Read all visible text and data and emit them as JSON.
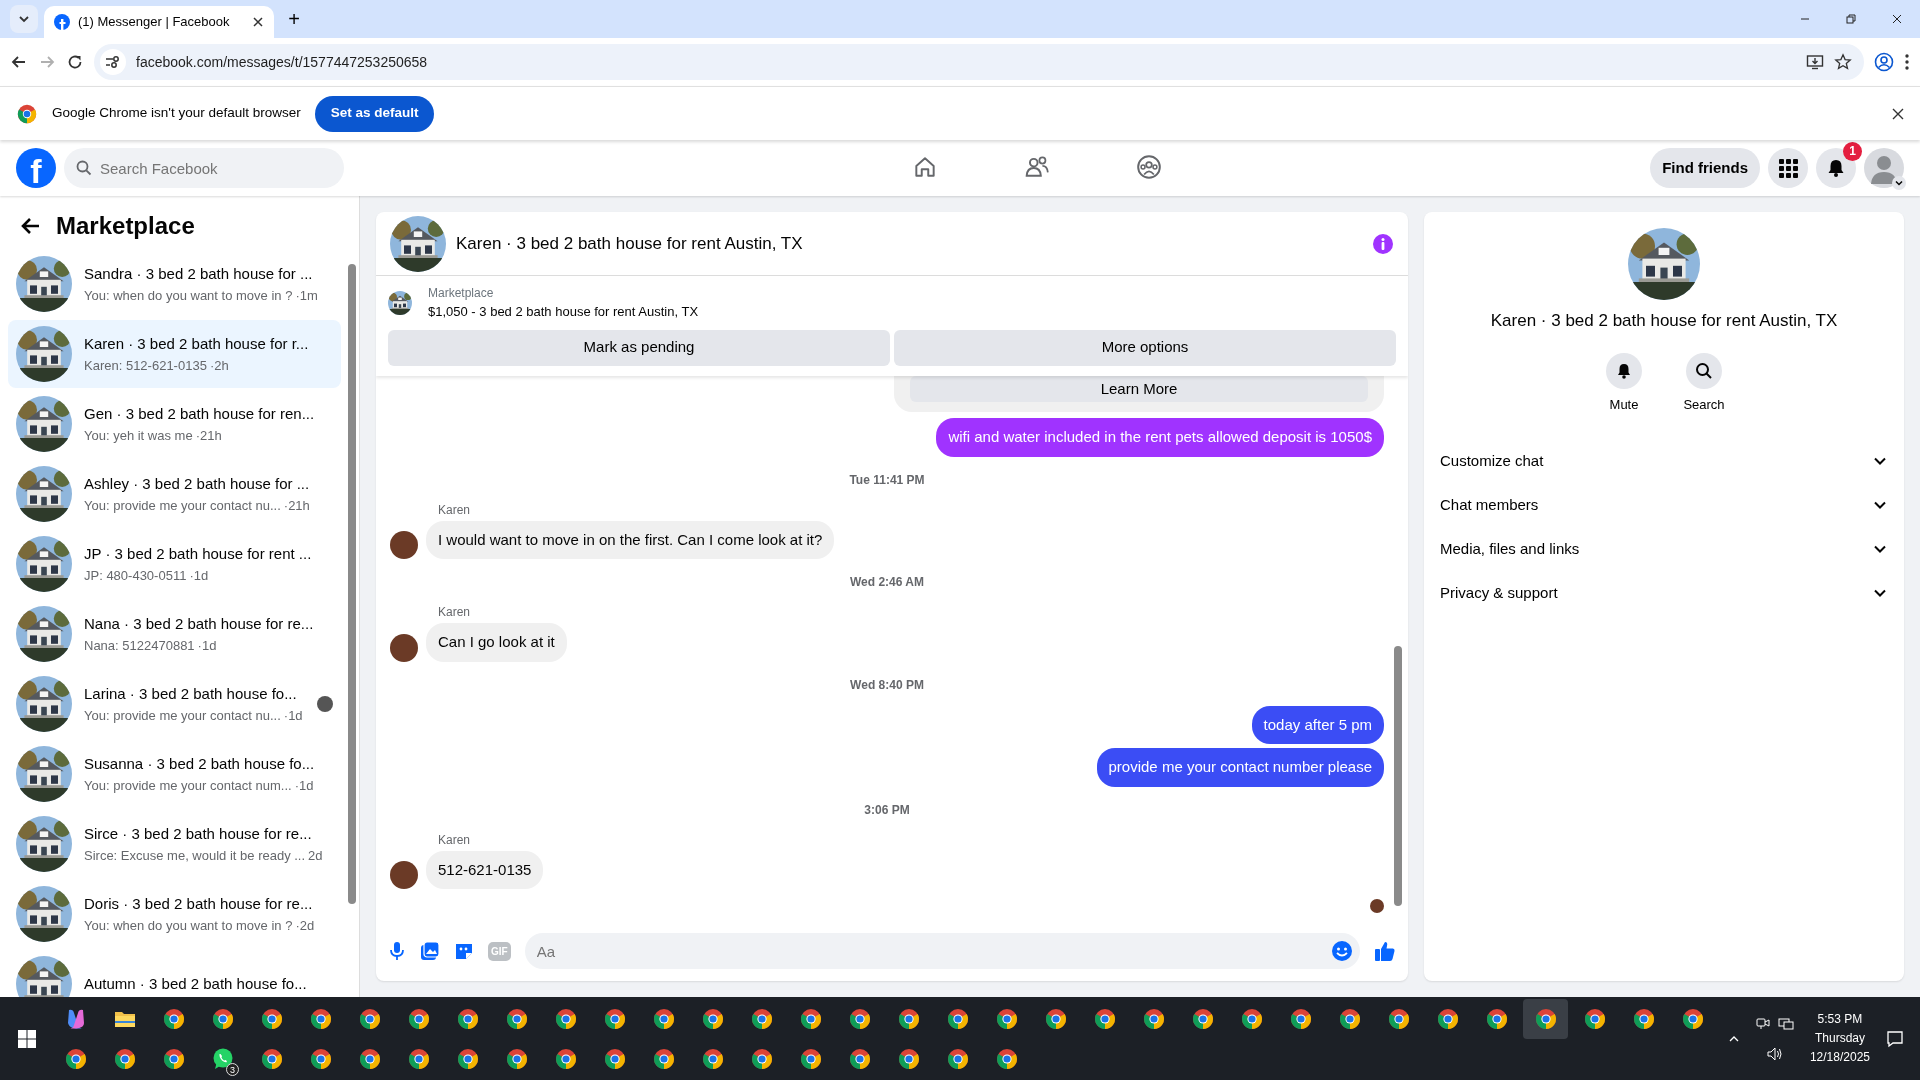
{
  "browser": {
    "tab": {
      "title": "(1) Messenger | Facebook",
      "selected": true
    },
    "new_tab": "+",
    "forward_disabled": true,
    "url": "facebook.com/messages/t/1577447253250658"
  },
  "infobar": {
    "text": "Google Chrome isn't your default browser",
    "button": "Set as default"
  },
  "facebook": {
    "logo": "f",
    "search": {
      "placeholder": "Search Facebook"
    },
    "nav": [
      {
        "kind": "home",
        "selected": false
      },
      {
        "kind": "friends",
        "selected": false
      },
      {
        "kind": "groups",
        "selected": false
      }
    ],
    "find_friends": "Find friends",
    "notifications_badge": "1"
  },
  "sidebar": {
    "title": "Marketplace",
    "conversations": [
      {
        "title": "Sandra · 3 bed 2 bath house for ...",
        "preview": "You: when do you want to move in ?",
        "time": "·1m",
        "selected": false,
        "seen": false
      },
      {
        "title": "Karen · 3 bed 2 bath house for r...",
        "preview": "Karen: 512-621-0135",
        "time": "·2h",
        "selected": true,
        "seen": false
      },
      {
        "title": "Gen · 3 bed 2 bath house for ren...",
        "preview": "You: yeh it was me",
        "time": "·21h",
        "selected": false,
        "seen": false
      },
      {
        "title": "Ashley · 3 bed 2 bath house for ...",
        "preview": "You: provide me your contact nu...",
        "time": "·21h",
        "selected": false,
        "seen": false
      },
      {
        "title": "JP · 3 bed 2 bath house for rent ...",
        "preview": "JP: 480-430-0511",
        "time": "·1d",
        "selected": false,
        "seen": false
      },
      {
        "title": "Nana · 3 bed 2 bath house for re...",
        "preview": "Nana: 5122470881",
        "time": "·1d",
        "selected": false,
        "seen": false
      },
      {
        "title": "Larina · 3 bed 2 bath house fo...",
        "preview": "You: provide me your contact nu...",
        "time": "·1d",
        "selected": false,
        "seen": true
      },
      {
        "title": "Susanna · 3 bed 2 bath house fo...",
        "preview": "You: provide me your contact num...",
        "time": "·1d",
        "selected": false,
        "seen": false
      },
      {
        "title": "Sirce · 3 bed 2 bath house for re...",
        "preview": "Sirce: Excuse me, would it be ready ...",
        "time": "2d",
        "selected": false,
        "seen": false
      },
      {
        "title": "Doris · 3 bed 2 bath house for re...",
        "preview": "You: when do you want to move in ?",
        "time": "·2d",
        "selected": false,
        "seen": false
      },
      {
        "title": "Autumn · 3 bed 2 bath house fo...",
        "selected": false,
        "seen": false
      }
    ]
  },
  "chat": {
    "title": "Karen · 3 bed 2 bath house for rent Austin, TX",
    "listing": {
      "label": "Marketplace",
      "text": "$1,050 - 3 bed 2 bath house for rent Austin, TX"
    },
    "buttons": [
      "Mark as pending",
      "More options"
    ],
    "messages": [
      {
        "kind": "card",
        "button": "Learn More"
      },
      {
        "kind": "outgoing",
        "text": "wifi and water included in the rent pets allowed deposit is 1050$",
        "color": "#a033ff"
      },
      {
        "kind": "timestamp",
        "text": "Tue 11:41 PM"
      },
      {
        "kind": "incoming",
        "sender": "Karen",
        "text": "I would want to move in on the first. Can I come look at it?"
      },
      {
        "kind": "timestamp",
        "text": "Wed 2:46 AM"
      },
      {
        "kind": "incoming",
        "sender": "Karen",
        "text": "Can I go look at it"
      },
      {
        "kind": "timestamp",
        "text": "Wed 8:40 PM"
      },
      {
        "kind": "outgoing",
        "text": "today after 5 pm",
        "color": "#3b4df5"
      },
      {
        "kind": "outgoing",
        "text": "provide me your contact number please",
        "color": "#3b4df5"
      },
      {
        "kind": "timestamp",
        "text": "3:06 PM"
      },
      {
        "kind": "incoming",
        "sender": "Karen",
        "text": "512-621-0135"
      },
      {
        "kind": "seen"
      }
    ],
    "composer": {
      "gif": "GIF",
      "placeholder": "Aa"
    }
  },
  "details": {
    "title": "Karen · 3 bed 2 bath house for rent Austin, TX",
    "actions": [
      {
        "kind": "mute",
        "label": "Mute"
      },
      {
        "kind": "search",
        "label": "Search"
      }
    ],
    "sections": [
      {
        "label": "Customize chat",
        "expanded": false
      },
      {
        "label": "Chat members",
        "expanded": false
      },
      {
        "label": "Media, files and links",
        "expanded": false
      },
      {
        "label": "Privacy & support",
        "expanded": false
      }
    ]
  },
  "taskbar": {
    "rows": [
      [
        {
          "kind": "copilot",
          "selected": false
        },
        {
          "kind": "explorer",
          "selected": false
        },
        {
          "kind": "chrome",
          "selected": false
        },
        {
          "kind": "chrome",
          "selected": false
        },
        {
          "kind": "chrome",
          "selected": false
        },
        {
          "kind": "chrome",
          "selected": false
        },
        {
          "kind": "chrome",
          "selected": false
        },
        {
          "kind": "chrome",
          "selected": false
        },
        {
          "kind": "chrome",
          "selected": false
        },
        {
          "kind": "chrome",
          "selected": false
        },
        {
          "kind": "chrome",
          "selected": false
        },
        {
          "kind": "chrome",
          "selected": false
        },
        {
          "kind": "chrome",
          "selected": false
        },
        {
          "kind": "chrome",
          "selected": false
        },
        {
          "kind": "chrome",
          "selected": false
        },
        {
          "kind": "chrome",
          "selected": false
        },
        {
          "kind": "chrome",
          "selected": false
        },
        {
          "kind": "chrome",
          "selected": false
        },
        {
          "kind": "chrome",
          "selected": false
        },
        {
          "kind": "chrome",
          "selected": false
        },
        {
          "kind": "chrome",
          "selected": false
        },
        {
          "kind": "chrome",
          "selected": false
        },
        {
          "kind": "chrome",
          "selected": false
        },
        {
          "kind": "chrome",
          "selected": false
        },
        {
          "kind": "chrome",
          "selected": false
        },
        {
          "kind": "chrome",
          "selected": false
        },
        {
          "kind": "chrome",
          "selected": false
        },
        {
          "kind": "chrome",
          "selected": false
        },
        {
          "kind": "chrome",
          "selected": false
        },
        {
          "kind": "chrome",
          "selected": false
        },
        {
          "kind": "chrome",
          "selected": true
        },
        {
          "kind": "chrome",
          "selected": false
        },
        {
          "kind": "chrome",
          "selected": false
        },
        {
          "kind": "chrome",
          "selected": false
        }
      ],
      [
        {
          "kind": "chrome",
          "selected": false
        },
        {
          "kind": "chrome",
          "selected": false
        },
        {
          "kind": "chrome",
          "selected": false
        },
        {
          "kind": "whatsapp",
          "badge": "3",
          "selected": false
        },
        {
          "kind": "chrome",
          "selected": false
        },
        {
          "kind": "chrome",
          "selected": false
        },
        {
          "kind": "chrome",
          "selected": false
        },
        {
          "kind": "chrome",
          "selected": false
        },
        {
          "kind": "chrome",
          "selected": false
        },
        {
          "kind": "chrome",
          "selected": false
        },
        {
          "kind": "chrome",
          "selected": false
        },
        {
          "kind": "chrome",
          "selected": false
        },
        {
          "kind": "chrome",
          "selected": false
        },
        {
          "kind": "chrome",
          "selected": false
        },
        {
          "kind": "chrome",
          "selected": false
        },
        {
          "kind": "chrome",
          "selected": false
        },
        {
          "kind": "chrome",
          "selected": false
        },
        {
          "kind": "chrome",
          "selected": false
        },
        {
          "kind": "chrome",
          "selected": false
        },
        {
          "kind": "chrome",
          "selected": false
        }
      ]
    ],
    "clock": {
      "time": "5:53 PM",
      "day": "Thursday",
      "date": "12/18/2025"
    }
  }
}
